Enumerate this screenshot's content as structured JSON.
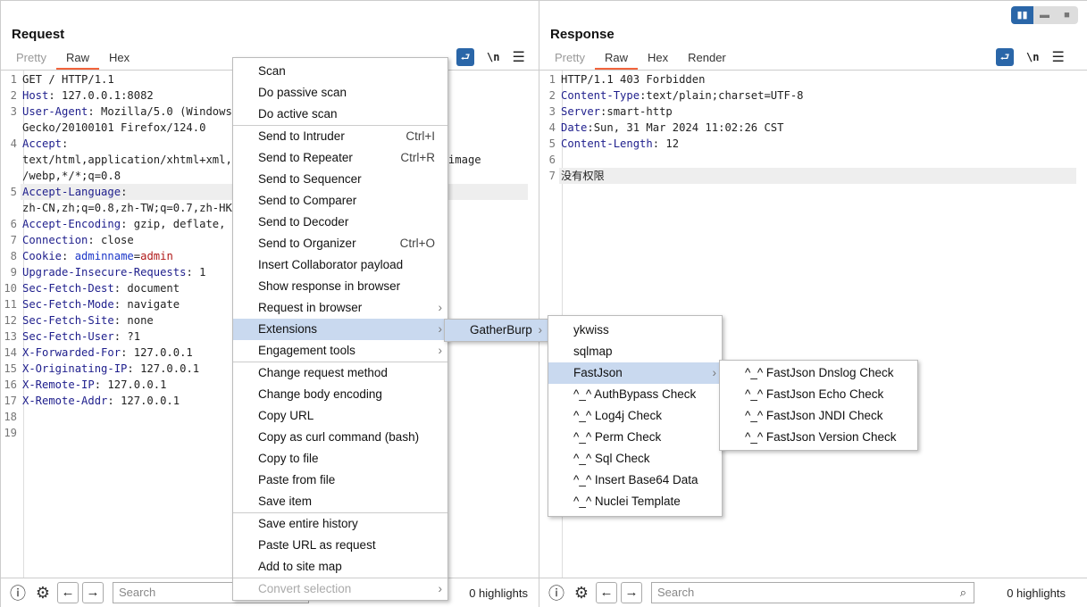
{
  "colors": {
    "accent": "#f2643c",
    "primary": "#2a66a8",
    "key": "#1e1e8c",
    "selected": "#c9d9ef"
  },
  "request": {
    "title": "Request",
    "tabs": [
      "Pretty",
      "Raw",
      "Hex"
    ],
    "active_tab": "Raw",
    "newline_label": "\\n",
    "rows": [
      {
        "n": "1",
        "parts": [
          [
            "v",
            "GET / HTTP/1.1"
          ]
        ]
      },
      {
        "n": "2",
        "parts": [
          [
            "k",
            "Host"
          ],
          [
            "v",
            ": 127.0.0.1:8082"
          ]
        ]
      },
      {
        "n": "3",
        "parts": [
          [
            "k",
            "User-Agent"
          ],
          [
            "v",
            ": Mozilla/5.0 (Windows NT 10.0; Win64; x64; rv:124.0)"
          ]
        ]
      },
      {
        "n": "",
        "parts": [
          [
            "v",
            "Gecko/20100101 Firefox/124.0"
          ]
        ]
      },
      {
        "n": "4",
        "parts": [
          [
            "k",
            "Accept"
          ],
          [
            "v",
            ":"
          ]
        ]
      },
      {
        "n": "",
        "parts": [
          [
            "v",
            "text/html,application/xhtml+xml,application/xml;q=0.9,image/avif,image"
          ]
        ]
      },
      {
        "n": "",
        "parts": [
          [
            "v",
            "/webp,*/*;q=0.8"
          ]
        ]
      },
      {
        "n": "5",
        "hl": true,
        "parts": [
          [
            "k",
            "Accept-Language"
          ],
          [
            "v",
            ":"
          ]
        ]
      },
      {
        "n": "",
        "parts": [
          [
            "v",
            "zh-CN,zh;q=0.8,zh-TW;q=0.7,zh-HK;q=0.5,en-US;q=0.3,en;q=0.2"
          ]
        ]
      },
      {
        "n": "6",
        "parts": [
          [
            "k",
            "Accept-Encoding"
          ],
          [
            "v",
            ": gzip, deflate, br"
          ]
        ]
      },
      {
        "n": "7",
        "parts": [
          [
            "k",
            "Connection"
          ],
          [
            "v",
            ": close"
          ]
        ]
      },
      {
        "n": "8",
        "parts": [
          [
            "k",
            "Cookie"
          ],
          [
            "v",
            ": "
          ],
          [
            "cn",
            "adminname"
          ],
          [
            "v",
            "="
          ],
          [
            "cv",
            "admin"
          ]
        ]
      },
      {
        "n": "9",
        "parts": [
          [
            "k",
            "Upgrade-Insecure-Requests"
          ],
          [
            "v",
            ": 1"
          ]
        ]
      },
      {
        "n": "10",
        "parts": [
          [
            "k",
            "Sec-Fetch-Dest"
          ],
          [
            "v",
            ": document"
          ]
        ]
      },
      {
        "n": "11",
        "parts": [
          [
            "k",
            "Sec-Fetch-Mode"
          ],
          [
            "v",
            ": navigate"
          ]
        ]
      },
      {
        "n": "12",
        "parts": [
          [
            "k",
            "Sec-Fetch-Site"
          ],
          [
            "v",
            ": none"
          ]
        ]
      },
      {
        "n": "13",
        "parts": [
          [
            "k",
            "Sec-Fetch-User"
          ],
          [
            "v",
            ": ?1"
          ]
        ]
      },
      {
        "n": "14",
        "parts": [
          [
            "k",
            "X-Forwarded-For"
          ],
          [
            "v",
            ": 127.0.0.1"
          ]
        ]
      },
      {
        "n": "15",
        "parts": [
          [
            "k",
            "X-Originating-IP"
          ],
          [
            "v",
            ": 127.0.0.1"
          ]
        ]
      },
      {
        "n": "16",
        "parts": [
          [
            "k",
            "X-Remote-IP"
          ],
          [
            "v",
            ": 127.0.0.1"
          ]
        ]
      },
      {
        "n": "17",
        "parts": [
          [
            "k",
            "X-Remote-Addr"
          ],
          [
            "v",
            ": 127.0.0.1"
          ]
        ]
      },
      {
        "n": "18",
        "parts": []
      },
      {
        "n": "19",
        "parts": []
      }
    ],
    "search_placeholder": "Search",
    "highlights": "0 highlights"
  },
  "response": {
    "title": "Response",
    "tabs": [
      "Pretty",
      "Raw",
      "Hex",
      "Render"
    ],
    "active_tab": "Raw",
    "newline_label": "\\n",
    "rows": [
      {
        "n": "1",
        "parts": [
          [
            "v",
            "HTTP/1.1 403 Forbidden"
          ]
        ]
      },
      {
        "n": "2",
        "parts": [
          [
            "k",
            "Content-Type"
          ],
          [
            "v",
            ":text/plain;charset=UTF-8"
          ]
        ]
      },
      {
        "n": "3",
        "parts": [
          [
            "k",
            "Server"
          ],
          [
            "v",
            ":smart-http"
          ]
        ]
      },
      {
        "n": "4",
        "parts": [
          [
            "k",
            "Date"
          ],
          [
            "v",
            ":Sun, 31 Mar 2024 11:02:26 CST"
          ]
        ]
      },
      {
        "n": "5",
        "parts": [
          [
            "k",
            "Content-Length"
          ],
          [
            "v",
            ": 12"
          ]
        ]
      },
      {
        "n": "6",
        "parts": []
      },
      {
        "n": "7",
        "hl": true,
        "parts": [
          [
            "v",
            "没有权限"
          ]
        ]
      }
    ],
    "search_placeholder": "Search",
    "highlights": "0 highlights"
  },
  "context_menu": [
    {
      "label": "Scan"
    },
    {
      "label": "Do passive scan"
    },
    {
      "label": "Do active scan",
      "sep": true
    },
    {
      "label": "Send to Intruder",
      "shortcut": "Ctrl+I"
    },
    {
      "label": "Send to Repeater",
      "shortcut": "Ctrl+R"
    },
    {
      "label": "Send to Sequencer"
    },
    {
      "label": "Send to Comparer"
    },
    {
      "label": "Send to Decoder"
    },
    {
      "label": "Send to Organizer",
      "shortcut": "Ctrl+O"
    },
    {
      "label": "Insert Collaborator payload"
    },
    {
      "label": "Show response in browser"
    },
    {
      "label": "Request in browser",
      "sub": true
    },
    {
      "label": "Extensions",
      "sub": true,
      "selected": true
    },
    {
      "label": "Engagement tools",
      "sub": true,
      "sep": true
    },
    {
      "label": "Change request method"
    },
    {
      "label": "Change body encoding"
    },
    {
      "label": "Copy URL"
    },
    {
      "label": "Copy as curl command (bash)"
    },
    {
      "label": "Copy to file"
    },
    {
      "label": "Paste from file"
    },
    {
      "label": "Save item",
      "sep": true
    },
    {
      "label": "Save entire history"
    },
    {
      "label": "Paste URL as request"
    },
    {
      "label": "Add to site map",
      "sep": true
    },
    {
      "label": "Convert selection",
      "sub": true,
      "disabled": true
    }
  ],
  "extensions_menu": [
    {
      "label": "GatherBurp",
      "sub": true,
      "selected": true
    }
  ],
  "gatherburp_menu": [
    {
      "label": "ykwiss"
    },
    {
      "label": "sqlmap"
    },
    {
      "label": "FastJson",
      "sub": true,
      "selected": true
    },
    {
      "label": "^_^ AuthBypass Check"
    },
    {
      "label": "^_^ Log4j Check"
    },
    {
      "label": "^_^ Perm Check"
    },
    {
      "label": "^_^ Sql Check"
    },
    {
      "label": "^_^ Insert Base64 Data"
    },
    {
      "label": "^_^ Nuclei Template"
    }
  ],
  "fastjson_menu": [
    {
      "label": "^_^ FastJson Dnslog Check"
    },
    {
      "label": "^_^ FastJson Echo Check"
    },
    {
      "label": "^_^ FastJson JNDI Check"
    },
    {
      "label": "^_^ FastJson Version Check"
    }
  ]
}
